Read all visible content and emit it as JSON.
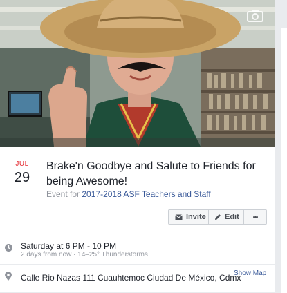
{
  "event": {
    "month": "JUL",
    "day": "29",
    "title": "Brake'n Goodbye and Salute to Friends for being Awesome!",
    "event_for_prefix": "Event for",
    "event_for_group": "2017-2018 ASF Teachers and Staff"
  },
  "actions": {
    "invite_label": "Invite",
    "edit_label": "Edit",
    "more_label": "•••"
  },
  "details": {
    "when_main": "Saturday at 6 PM - 10 PM",
    "when_sub": "2 days from now · 14–25° Thunderstorms",
    "where": "Calle Rio Nazas 111 Cuauhtemoc Ciudad De México, Cdmx",
    "show_map_label": "Show Map"
  },
  "icons": {
    "cover_camera": "camera-icon",
    "invite": "envelope-icon",
    "edit": "pencil-icon",
    "when": "clock-icon",
    "where": "map-pin-icon"
  },
  "colors": {
    "month_red": "#e4262c",
    "link_blue": "#385898",
    "muted_gray": "#90949c"
  }
}
